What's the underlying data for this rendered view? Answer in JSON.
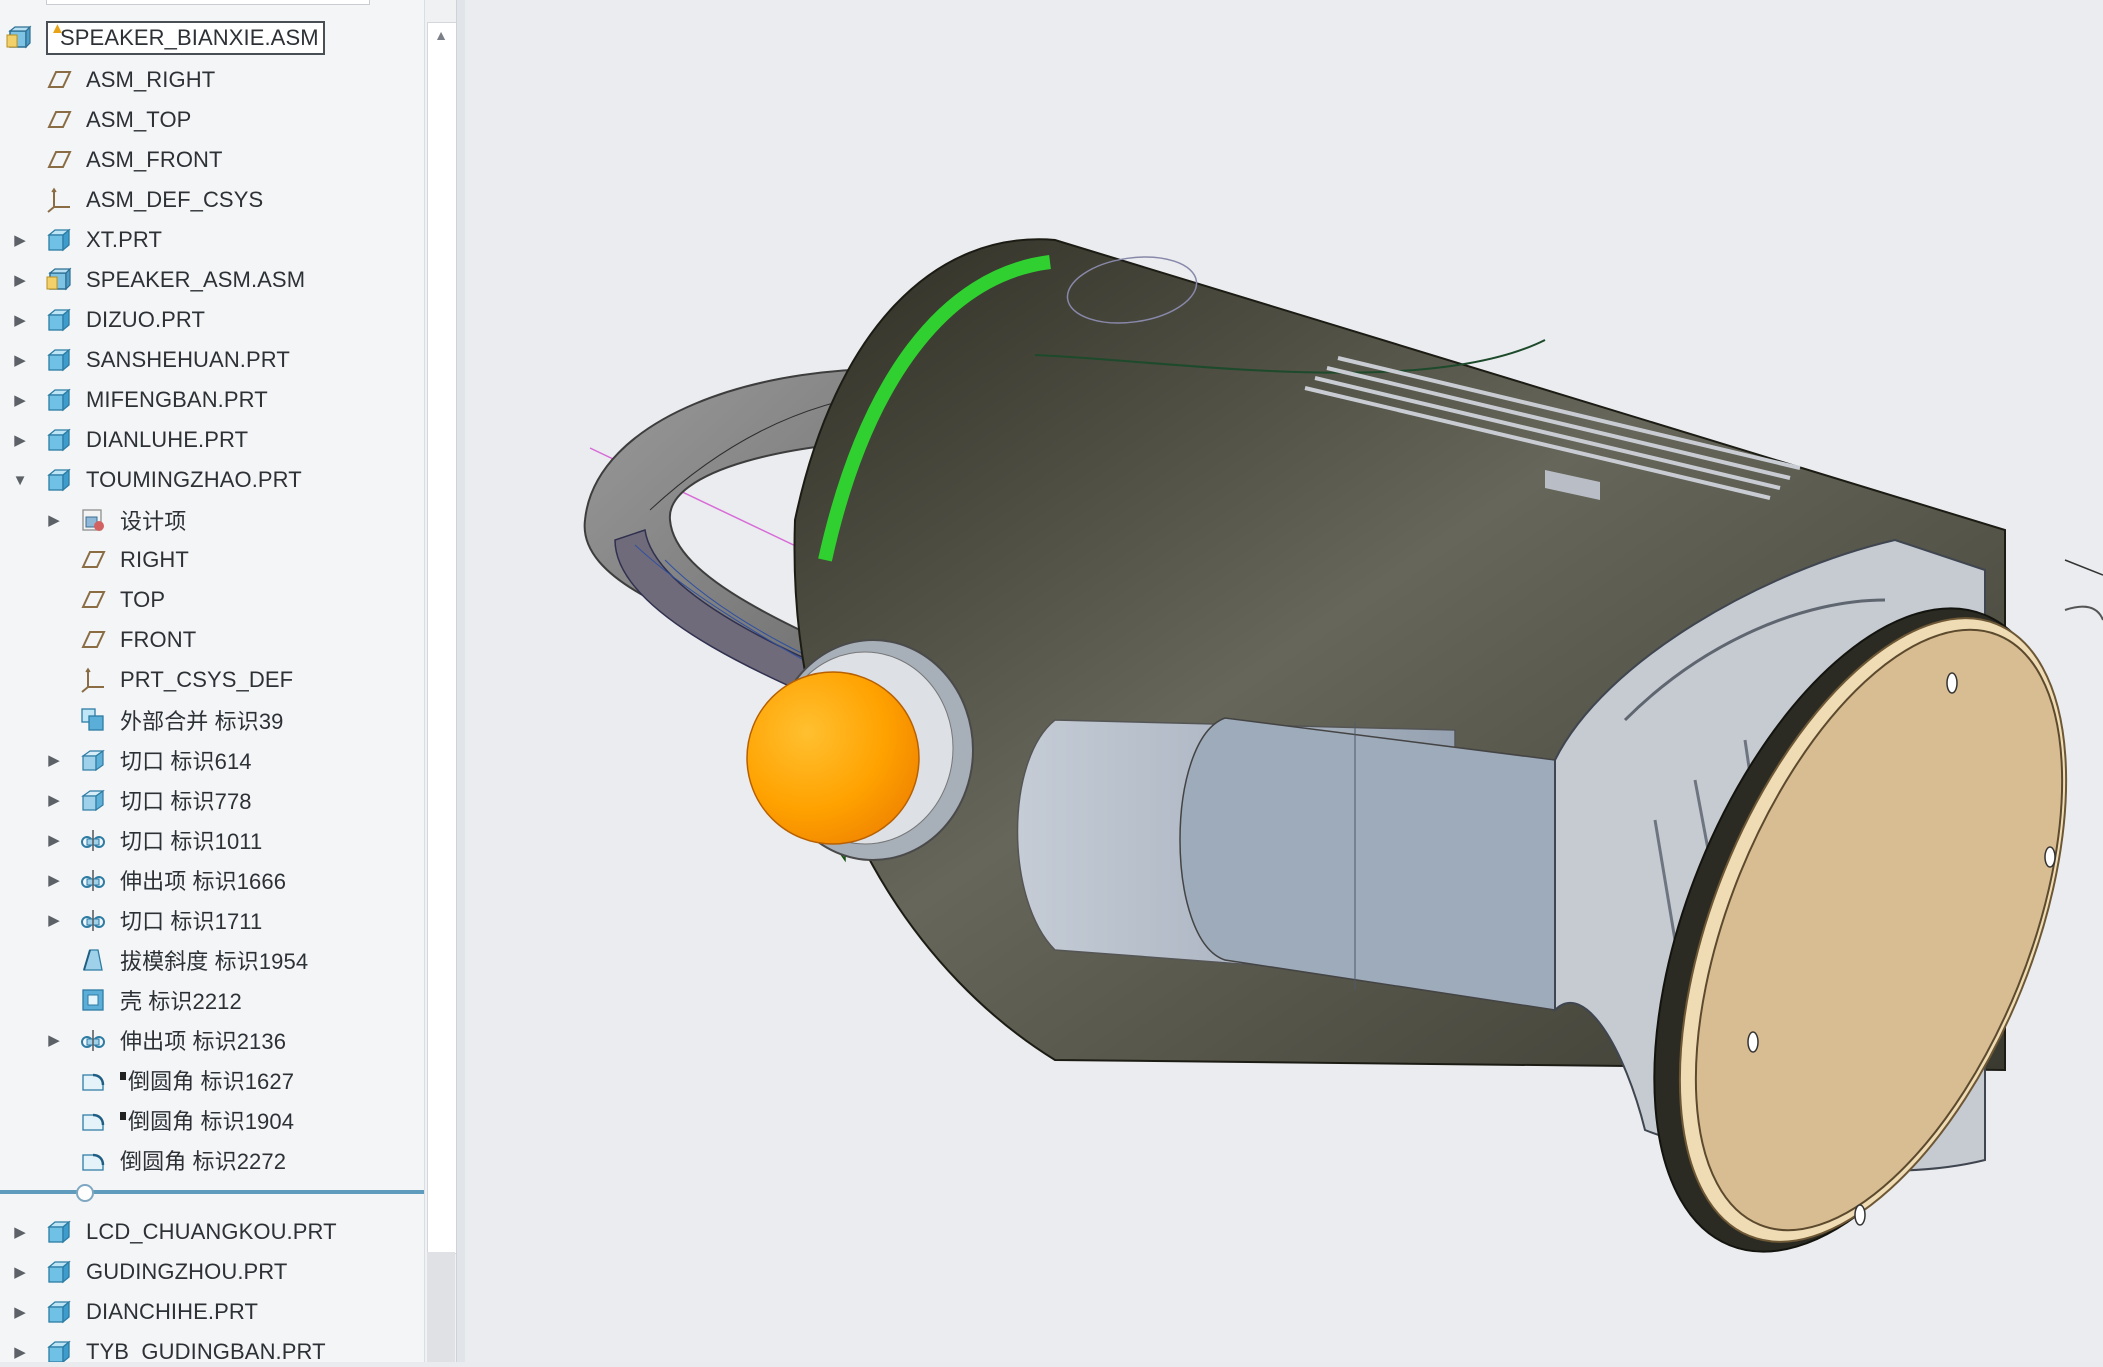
{
  "model_tree": {
    "root": {
      "label": "SPEAKER_BIANXIE.ASM",
      "icon": "assembly-icon",
      "warning_icon": "warning-icon"
    },
    "items": [
      {
        "label": "ASM_RIGHT",
        "icon": "datum-plane-icon",
        "level": 1,
        "expandable": false
      },
      {
        "label": "ASM_TOP",
        "icon": "datum-plane-icon",
        "level": 1,
        "expandable": false
      },
      {
        "label": "ASM_FRONT",
        "icon": "datum-plane-icon",
        "level": 1,
        "expandable": false
      },
      {
        "label": "ASM_DEF_CSYS",
        "icon": "csys-icon",
        "level": 1,
        "expandable": false
      },
      {
        "label": "XT.PRT",
        "icon": "part-icon",
        "level": 1,
        "expandable": true,
        "expanded": false
      },
      {
        "label": "SPEAKER_ASM.ASM",
        "icon": "assembly-icon",
        "level": 1,
        "expandable": true,
        "expanded": false
      },
      {
        "label": "DIZUO.PRT",
        "icon": "part-icon",
        "level": 1,
        "expandable": true,
        "expanded": false
      },
      {
        "label": "SANSHEHUAN.PRT",
        "icon": "part-icon",
        "level": 1,
        "expandable": true,
        "expanded": false
      },
      {
        "label": "MIFENGBAN.PRT",
        "icon": "part-icon",
        "level": 1,
        "expandable": true,
        "expanded": false
      },
      {
        "label": "DIANLUHE.PRT",
        "icon": "part-icon",
        "level": 1,
        "expandable": true,
        "expanded": false
      },
      {
        "label": "TOUMINGZHAO.PRT",
        "icon": "part-icon",
        "level": 1,
        "expandable": true,
        "expanded": true
      },
      {
        "label": "设计项",
        "icon": "design-items-icon",
        "level": 2,
        "expandable": true,
        "expanded": false
      },
      {
        "label": "RIGHT",
        "icon": "datum-plane-icon",
        "level": 2,
        "expandable": false
      },
      {
        "label": "TOP",
        "icon": "datum-plane-icon",
        "level": 2,
        "expandable": false
      },
      {
        "label": "FRONT",
        "icon": "datum-plane-icon",
        "level": 2,
        "expandable": false
      },
      {
        "label": "PRT_CSYS_DEF",
        "icon": "csys-icon",
        "level": 2,
        "expandable": false
      },
      {
        "label": "外部合并 标识39",
        "icon": "merge-icon",
        "level": 2,
        "expandable": false
      },
      {
        "label": "切口 标识614",
        "icon": "cut-icon",
        "level": 2,
        "expandable": true,
        "expanded": false
      },
      {
        "label": "切口 标识778",
        "icon": "cut-icon",
        "level": 2,
        "expandable": true,
        "expanded": false
      },
      {
        "label": "切口 标识1011",
        "icon": "revolve-icon",
        "level": 2,
        "expandable": true,
        "expanded": false
      },
      {
        "label": "伸出项 标识1666",
        "icon": "revolve-icon",
        "level": 2,
        "expandable": true,
        "expanded": false
      },
      {
        "label": "切口 标识1711",
        "icon": "revolve-icon",
        "level": 2,
        "expandable": true,
        "expanded": false
      },
      {
        "label": "拔模斜度 标识1954",
        "icon": "draft-icon",
        "level": 2,
        "expandable": false
      },
      {
        "label": "壳 标识2212",
        "icon": "shell-icon",
        "level": 2,
        "expandable": false
      },
      {
        "label": "伸出项 标识2136",
        "icon": "revolve-icon",
        "level": 2,
        "expandable": true,
        "expanded": false
      },
      {
        "label": "倒圆角 标识1627",
        "icon": "round-icon",
        "level": 2,
        "expandable": false,
        "marker": true
      },
      {
        "label": "倒圆角 标识1904",
        "icon": "round-icon",
        "level": 2,
        "expandable": false,
        "marker": true
      },
      {
        "label": "倒圆角 标识2272",
        "icon": "round-icon",
        "level": 2,
        "expandable": false
      }
    ],
    "items_after_insert": [
      {
        "label": "LCD_CHUANGKOU.PRT",
        "icon": "part-icon",
        "level": 1,
        "expandable": true,
        "expanded": false
      },
      {
        "label": "GUDINGZHOU.PRT",
        "icon": "part-icon",
        "level": 1,
        "expandable": true,
        "expanded": false
      },
      {
        "label": "DIANCHIHE.PRT",
        "icon": "part-icon",
        "level": 1,
        "expandable": true,
        "expanded": false
      },
      {
        "label": "TYB_GUDINGBAN.PRT",
        "icon": "part-icon",
        "level": 1,
        "expandable": true,
        "expanded": false
      }
    ]
  },
  "colors": {
    "body_dark": "#5b5b4a",
    "button_orange": "#ff9d00",
    "highlight_green": "#2fd02f",
    "base_tan": "#d9bd92",
    "accent_blue": "#5e9bbd"
  }
}
